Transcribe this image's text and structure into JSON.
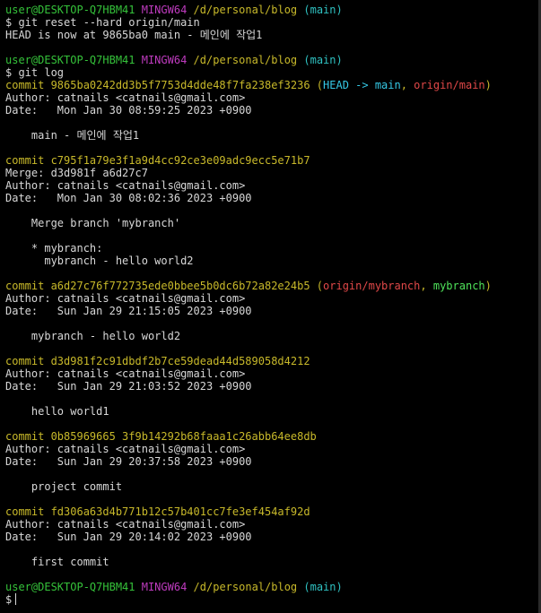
{
  "colors": {
    "background": "#000000",
    "text": "#d8d8d8",
    "prompt_user": "#35c23a",
    "prompt_env": "#bf3bbf",
    "prompt_path": "#c8b92a",
    "prompt_branch": "#2fc1c1",
    "commit": "#c8b92a",
    "head_ref": "#35c9e6",
    "remote_ref": "#e04848",
    "local_ref": "#4fe35a"
  },
  "prompts": [
    {
      "user": "user@DESKTOP-Q7HBM41",
      "env": "MINGW64",
      "path": "/d/personal/blog",
      "branch": "(main)"
    },
    {
      "user": "user@DESKTOP-Q7HBM41",
      "env": "MINGW64",
      "path": "/d/personal/blog",
      "branch": "(main)"
    },
    {
      "user": "user@DESKTOP-Q7HBM41",
      "env": "MINGW64",
      "path": "/d/personal/blog",
      "branch": "(main)"
    }
  ],
  "commands": {
    "reset": "$ git reset --hard origin/main",
    "reset_output": "HEAD is now at 9865ba0 main - 메인에 작업1",
    "log": "$ git log",
    "final_prompt": "$"
  },
  "commits": [
    {
      "commit_line": "commit 9865ba0242dd3b5f7753d4dde48f7fa238ef3236",
      "refs": {
        "open": " (",
        "head": "HEAD -> main",
        "sep": ", ",
        "remote": "origin/main",
        "close": ")"
      },
      "author": "Author: catnails <catnails@gmail.com>",
      "date": "Date:   Mon Jan 30 08:59:25 2023 +0900",
      "message": [
        "    main - 메인에 작업1"
      ]
    },
    {
      "commit_line": "commit c795f1a79e3f1a9d4cc92ce3e09adc9ecc5e71b7",
      "merge": "Merge: d3d981f a6d27c7",
      "author": "Author: catnails <catnails@gmail.com>",
      "date": "Date:   Mon Jan 30 08:02:36 2023 +0900",
      "message": [
        "    Merge branch 'mybranch'",
        "",
        "    * mybranch:",
        "      mybranch - hello world2"
      ]
    },
    {
      "commit_line": "commit a6d27c76f772735ede0bbee5b0dc6b72a82e24b5",
      "refs": {
        "open": " (",
        "remote": "origin/mybranch",
        "sep": ", ",
        "local": "mybranch",
        "close": ")"
      },
      "author": "Author: catnails <catnails@gmail.com>",
      "date": "Date:   Sun Jan 29 21:15:05 2023 +0900",
      "message": [
        "    mybranch - hello world2"
      ]
    },
    {
      "commit_line": "commit d3d981f2c91dbdf2b7ce59dead44d589058d4212",
      "author": "Author: catnails <catnails@gmail.com>",
      "date": "Date:   Sun Jan 29 21:03:52 2023 +0900",
      "message": [
        "    hello world1"
      ]
    },
    {
      "commit_line": "commit 0b85969665 3f9b14292b68faaa1c26abb64ee8db",
      "author": "Author: catnails <catnails@gmail.com>",
      "date": "Date:   Sun Jan 29 20:37:58 2023 +0900",
      "message": [
        "    project commit"
      ]
    },
    {
      "commit_line": "commit fd306a63d4b771b12c57b401cc7fe3ef454af92d",
      "author": "Author: catnails <catnails@gmail.com>",
      "date": "Date:   Sun Jan 29 20:14:02 2023 +0900",
      "message": [
        "    first commit"
      ]
    }
  ]
}
